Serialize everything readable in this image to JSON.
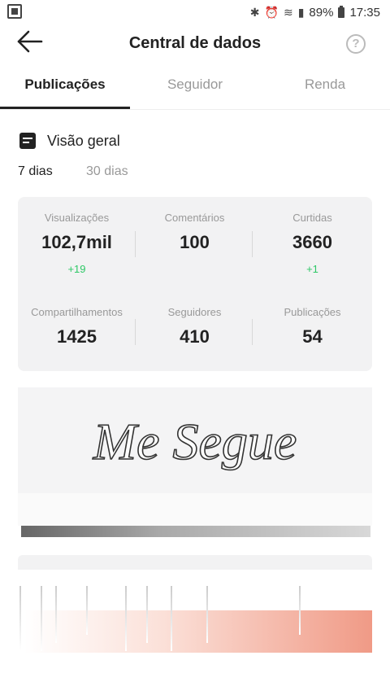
{
  "status_bar": {
    "battery": "89%",
    "time": "17:35"
  },
  "header": {
    "title": "Central de dados",
    "help_symbol": "?"
  },
  "tabs": [
    {
      "label": "Publicações",
      "active": true
    },
    {
      "label": "Seguidor",
      "active": false
    },
    {
      "label": "Renda",
      "active": false
    }
  ],
  "overview": {
    "title": "Visão geral",
    "ranges": [
      "7 dias",
      "30 dias"
    ],
    "selected_range": "7 dias"
  },
  "stats": [
    {
      "label": "Visualizações",
      "value": "102,7mil",
      "delta": "+19"
    },
    {
      "label": "Comentários",
      "value": "100",
      "delta": ""
    },
    {
      "label": "Curtidas",
      "value": "3660",
      "delta": "+1"
    },
    {
      "label": "Compartilhamentos",
      "value": "1425",
      "delta": ""
    },
    {
      "label": "Seguidores",
      "value": "410",
      "delta": ""
    },
    {
      "label": "Publicações",
      "value": "54",
      "delta": ""
    }
  ],
  "banner": {
    "text": "Me Segue"
  },
  "colors": {
    "accent_positive": "#2ec866",
    "tab_active": "#222222",
    "card_bg": "#f2f2f3"
  }
}
